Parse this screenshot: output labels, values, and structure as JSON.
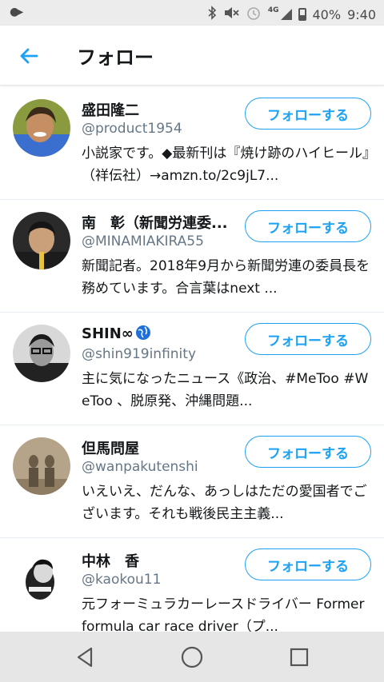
{
  "status_bar": {
    "network": "4G",
    "battery": "40%",
    "time": "9:40"
  },
  "header": {
    "title": "フォロー"
  },
  "follow_label": "フォローする",
  "users": [
    {
      "name": "盛田隆二",
      "handle": "@product1954",
      "bio": "小説家です。◆最新刊は『焼け跡のハイヒール』（祥伝社）→amzn.to/2c9jL7..."
    },
    {
      "name": "南　彰（新聞労連委...",
      "handle": "@MINAMIAKIRA55",
      "bio": "新聞記者。2018年9月から新聞労連の委員長を務めています。合言葉はnext ..."
    },
    {
      "name": "SHIN∞",
      "handle": "@shin919infinity",
      "bio": "主に気になったニュース《政治、#MeToo #WeToo 、脱原発、沖縄問題..."
    },
    {
      "name": "但馬問屋",
      "handle": "@wanpakutenshi",
      "bio": "いえいえ、だんな、あっしはただの愛国者でございます。それも戦後民主主義..."
    },
    {
      "name": "中林　香",
      "handle": "@kaokou11",
      "bio": "元フォーミュラカーレースドライバー Former formula car race driver（プ..."
    }
  ]
}
